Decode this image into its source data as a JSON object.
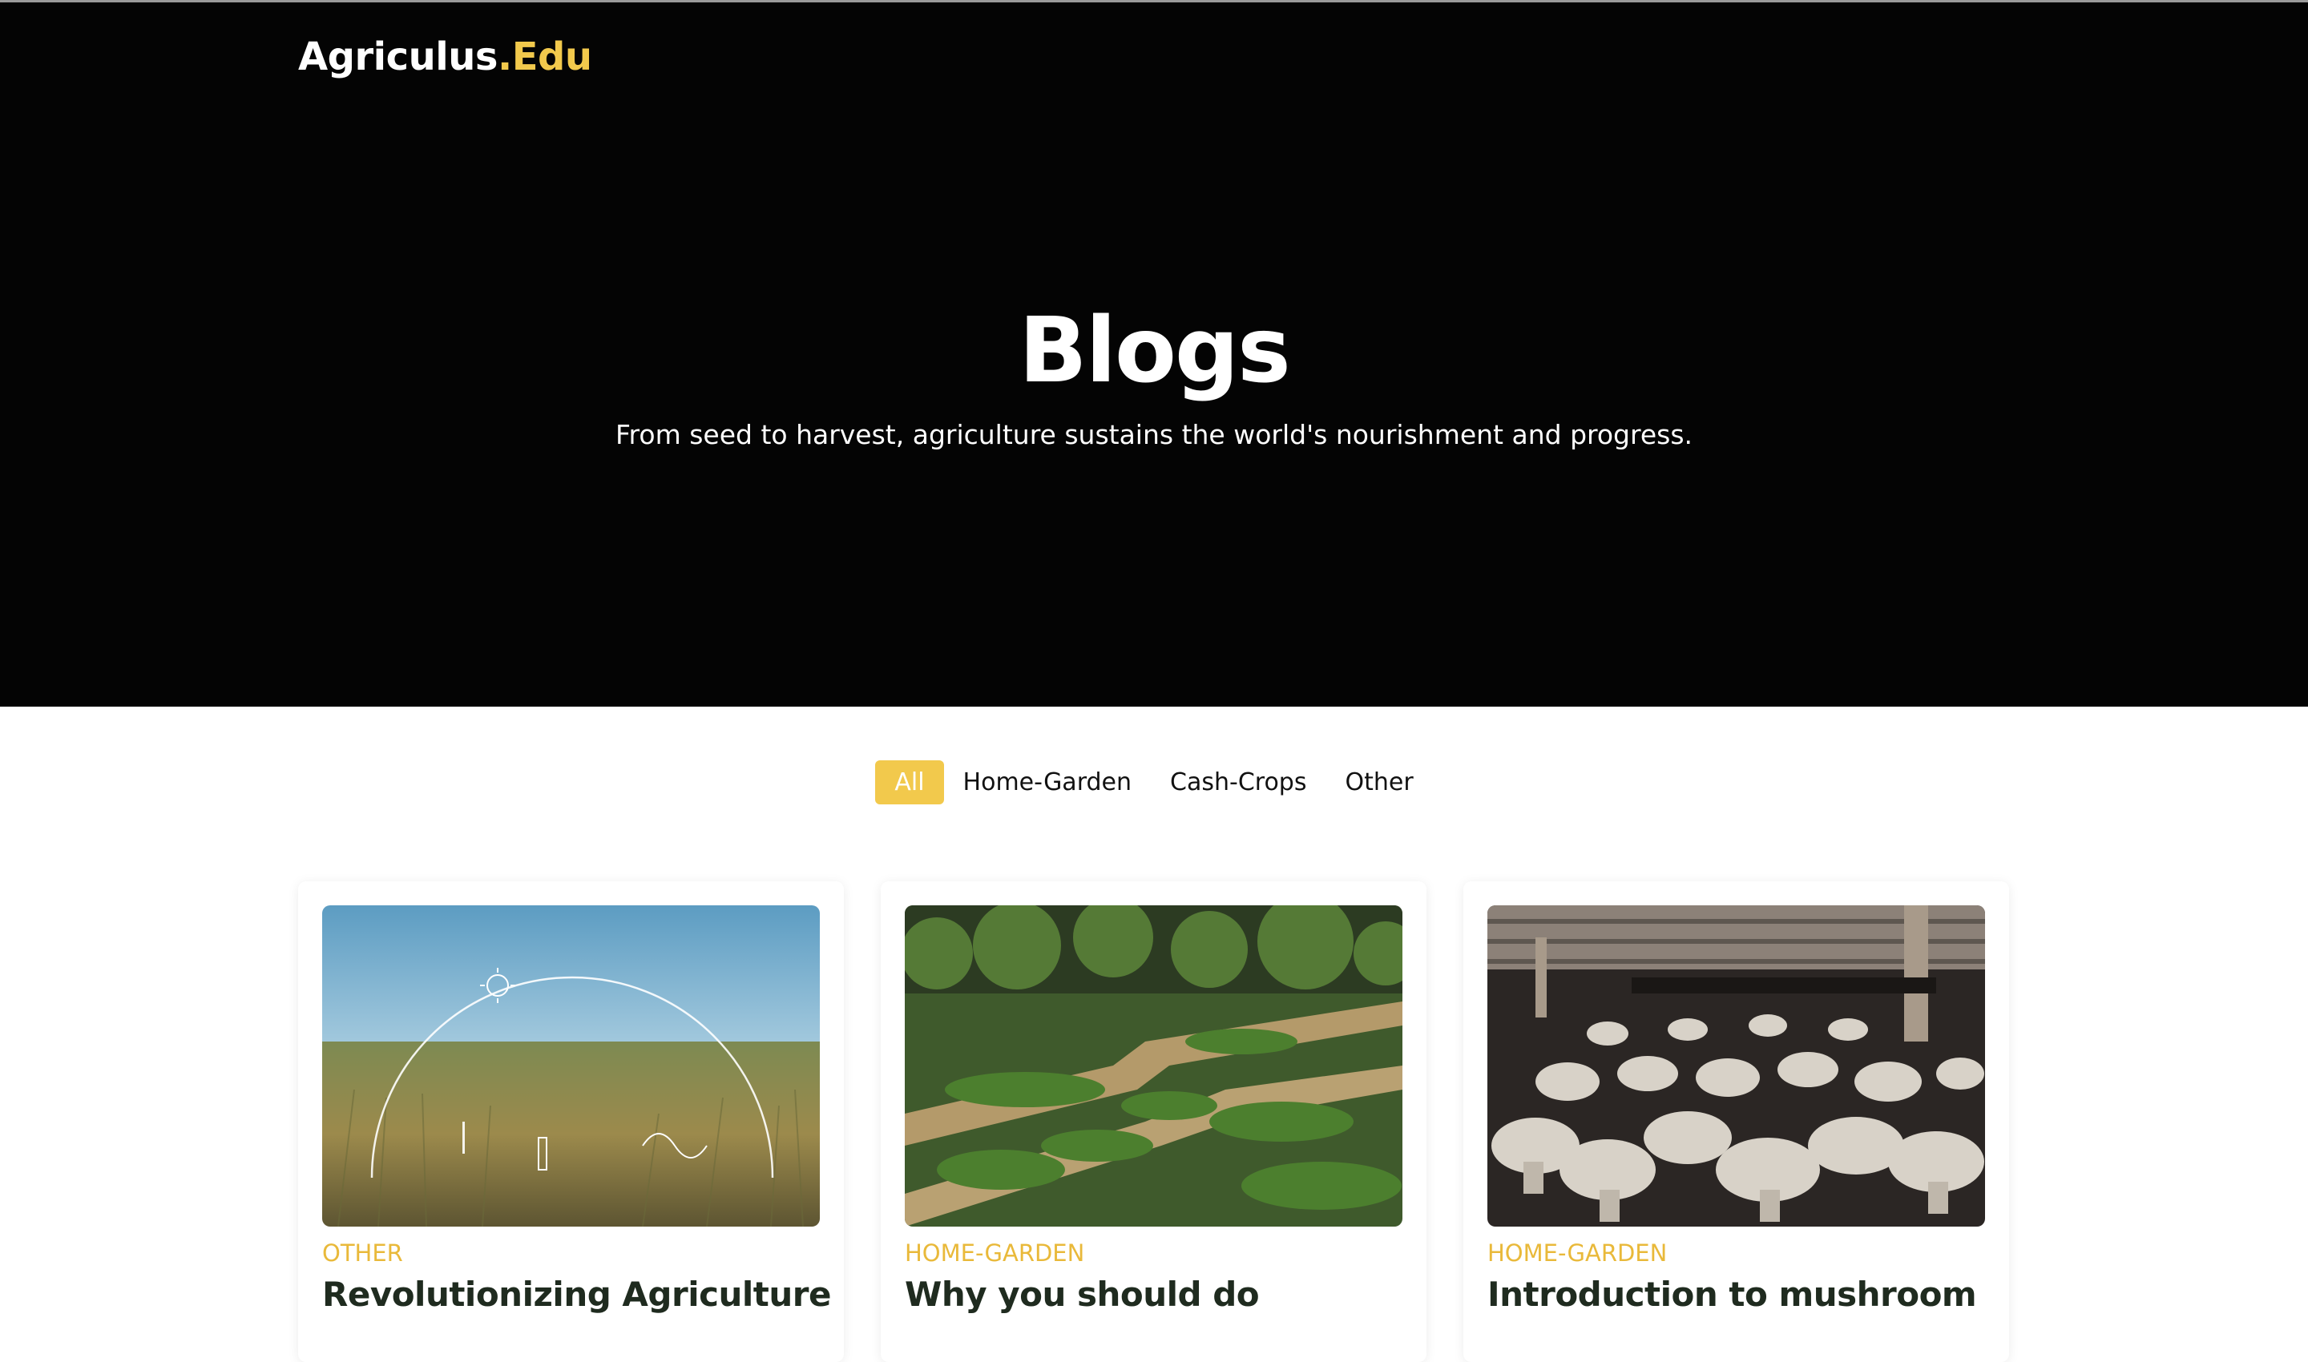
{
  "brand": {
    "name_main": "Agriculus",
    "name_accent": ".Edu"
  },
  "hero": {
    "title": "Blogs",
    "subtitle": "From seed to harvest, agriculture sustains the world's nourishment and progress."
  },
  "filters": [
    {
      "label": "All",
      "active": true
    },
    {
      "label": "Home-Garden",
      "active": false
    },
    {
      "label": "Cash-Crops",
      "active": false
    },
    {
      "label": "Other",
      "active": false
    }
  ],
  "posts": [
    {
      "category": "OTHER",
      "title": "Revolutionizing Agriculture",
      "image": "smart-farm-wheat-field-image"
    },
    {
      "category": "HOME-GARDEN",
      "title": "Why you should do",
      "image": "garden-beds-image"
    },
    {
      "category": "HOME-GARDEN",
      "title": "Introduction to mushroom",
      "image": "mushroom-farm-image"
    }
  ],
  "colors": {
    "accent": "#f2c94c",
    "hero_bg": "#040404",
    "title_text": "#1f2b1f"
  }
}
